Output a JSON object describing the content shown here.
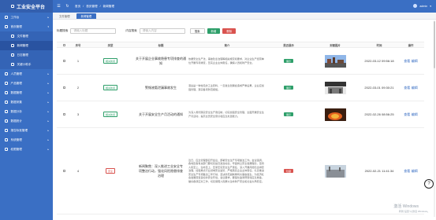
{
  "app": {
    "title": "工业安全平台"
  },
  "sidebar": {
    "items": [
      {
        "label": "工作台",
        "icon": "dashboard-icon",
        "expandable": true
      },
      {
        "label": "首页管理",
        "icon": "home-icon",
        "expanded": true,
        "children": [
          {
            "label": "文件管理",
            "active": false
          },
          {
            "label": "新闻管理",
            "active": true
          },
          {
            "label": "日志管理",
            "active": false
          },
          {
            "label": "关键小助手",
            "active": false
          }
        ]
      },
      {
        "label": "人员管理",
        "icon": "user-icon",
        "expandable": true
      },
      {
        "label": "产品管理",
        "icon": "product-icon",
        "expandable": true
      },
      {
        "label": "数据管理",
        "icon": "database-icon",
        "expandable": true
      },
      {
        "label": "数据采集",
        "icon": "collect-icon",
        "expandable": true
      },
      {
        "label": "数据分析",
        "icon": "chart-icon",
        "expandable": true
      },
      {
        "label": "数据统计",
        "icon": "stats-icon",
        "expandable": true
      },
      {
        "label": "报告标准管理",
        "icon": "report-icon",
        "expandable": true
      },
      {
        "label": "系统管理",
        "icon": "settings-icon",
        "expandable": true
      },
      {
        "label": "权限管理",
        "icon": "lock-icon",
        "expandable": true
      }
    ]
  },
  "topbar": {
    "breadcrumb": [
      "首页",
      "/",
      "首页管理",
      "/",
      "新闻管理"
    ],
    "user": "admin"
  },
  "tabs": [
    {
      "label": "文件管理",
      "active": false
    },
    {
      "label": "新闻管理",
      "active": true
    }
  ],
  "toolbar": {
    "title_label": "标题搜索",
    "title_placeholder": "请输入标题",
    "type_label": "内容搜索",
    "type_placeholder": "请输入内容",
    "search": "搜索",
    "add": "新增",
    "delete": "删除"
  },
  "table": {
    "columns": [
      "",
      "序号",
      "类型",
      "标题",
      "简介",
      "是否展示",
      "封面图片",
      "时间",
      "操作"
    ],
    "rows": [
      {
        "index": "1",
        "type": "相关新闻",
        "type_color": "green",
        "title": "关于开展企业事故隐患专项排查的通知",
        "summary": "依据安全生产法、事故隐患治理等相关规定和要求，对企业生产经营单位开展专项排查，压实企业主体责任，确保人员和财产安全。",
        "show": "展示",
        "show_color": "green",
        "image": "factory-image",
        "time": "2022-03-12 09:56:18"
      },
      {
        "index": "2",
        "type": "相关新闻",
        "type_color": "green",
        "title": "警惕液氨泄漏事故发生",
        "summary": "液氨是一种常见的工业原料，一旦发生泄漏会造成严重后果，企业应加强管理，落实各项防范措施。",
        "show": "展示",
        "show_color": "green",
        "image": "warehouse-image",
        "time": "2022-03-01 09:30:21"
      },
      {
        "index": "3",
        "type": "相关新闻",
        "type_color": "green",
        "title": "关于开展安全生产月活动的通知",
        "summary": "为深入贯彻落实安全生产责任制，切实加强安全管理，全面开展安全生产月活动，提高全员安全意识和应急处置能力。",
        "show": "展示",
        "show_color": "green",
        "image": "fire-image",
        "time": "2022-02-26 08:56:25"
      },
      {
        "index": "4",
        "type": "安全",
        "type_color": "red",
        "title": "新闻聚焦：深入推进工业安全专项整治行动，强化风险隐患排查治理",
        "summary": "近日，应急管理部召开会议，部署安全生产专项整治工作。会议强调，各地区各有关部门要切实提高政治站位，牢固树立安全发展理念，坚持人民至上、生命至上，压紧压实安全生产责任，深入开展风险隐患排查治理，加强重点行业领域安全监管，严格落实企业主体责任，扎实推进安全生产专项整治三年行动，坚决防范遏制重特大事故发生，为经济社会发展营造良好的安全环境。会议要求，要强化监测预警和应急准备，做好各项应对工作，切实保障人民群众生命财产安全和社会大局稳定。",
        "show": "隐藏",
        "show_color": "red",
        "image": "plant-image",
        "time": "2022-02-21 11:41:34"
      }
    ],
    "ops": {
      "view": "查看",
      "edit": "编辑"
    }
  },
  "watermark": {
    "line1": "激活 Windows",
    "line2": "转到\"设置\"以激活 Windows。"
  },
  "colors": {
    "primary": "#3a6fc4",
    "success": "#2e9f6a",
    "danger": "#d9534f"
  }
}
